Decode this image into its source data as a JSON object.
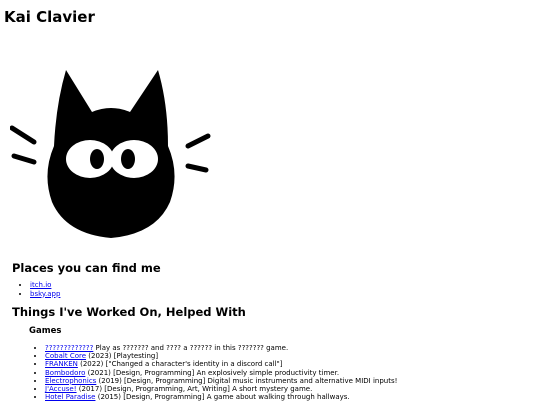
{
  "site": {
    "title": "Kai Clavier"
  },
  "avatar": {
    "icon": "black-cat-icon",
    "color": "#000000"
  },
  "places": {
    "heading": "Places you can find me",
    "links": [
      {
        "label": "itch.io"
      },
      {
        "label": "bsky.app"
      }
    ]
  },
  "things": {
    "heading": "Things I've Worked On, Helped With",
    "games_heading": "Games",
    "games": [
      {
        "link": "?????????????",
        "text": " Play as ??????? and ???? a ?????? in this ??????? game."
      },
      {
        "link": "Cobalt Core",
        "text": " (2023) [Playtesting]"
      },
      {
        "link": "FRANKEN",
        "text": " (2022) [\"Changed a character's identity in a discord call\"]"
      },
      {
        "link": "Bombodoro",
        "text": " (2021) [Design, Programming] An explosively simple productivity timer."
      },
      {
        "link": "Electrophonics",
        "text": " (2019) [Design, Programming] Digital music instruments and alternative MIDI inputs!"
      },
      {
        "link": "J'Accuse!",
        "text": " (2017) [Design, Programming, Art, Writing] A short mystery game."
      },
      {
        "link": "Hotel Paradise",
        "text": " (2015) [Design, Programming] A game about walking through hallways."
      }
    ]
  }
}
